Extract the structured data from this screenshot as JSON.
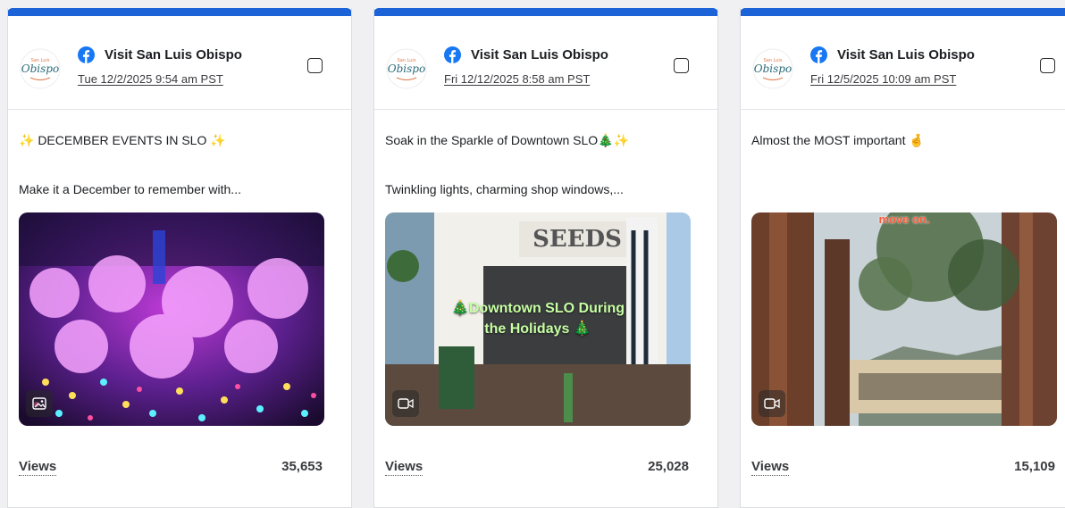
{
  "colors": {
    "accent": "#1b63d6",
    "facebook": "#1877f2"
  },
  "posts": [
    {
      "account": "Visit San Luis Obispo",
      "date": "Tue 12/2/2025 9:54 am PST",
      "line1": "✨ DECEMBER EVENTS IN SLO ✨",
      "line2": "Make it a December to remember with...",
      "media_type": "image-icon",
      "overlay": "",
      "views_label": "Views",
      "views": "35,653"
    },
    {
      "account": "Visit San Luis Obispo",
      "date": "Fri 12/12/2025 8:58 am PST",
      "line1": "Soak in the Sparkle of Downtown SLO🎄✨",
      "line2": "Twinkling lights, charming shop windows,...",
      "media_type": "video-icon",
      "overlay": "🎄Downtown SLO During the Holidays 🎄",
      "views_label": "Views",
      "views": "25,028"
    },
    {
      "account": "Visit San Luis Obispo",
      "date": "Fri 12/5/2025 10:09 am PST",
      "line1": "Almost the MOST important 🤞",
      "line2": "",
      "media_type": "video-icon",
      "overlay": "move on.",
      "views_label": "Views",
      "views": "15,109"
    }
  ]
}
